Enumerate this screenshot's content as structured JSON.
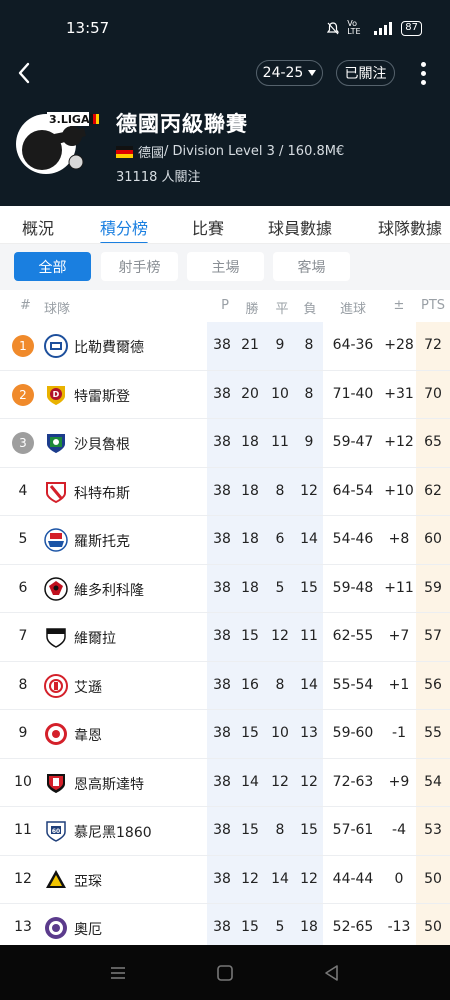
{
  "status": {
    "time": "13:57",
    "icons_text": "Vo LTE",
    "battery": "87"
  },
  "topbar": {
    "season": "24-25",
    "follow_label": "已關注"
  },
  "league": {
    "logo_text": "3.LIGA",
    "name": "德國丙級聯賽",
    "country": "德國",
    "meta_rest": " / Division Level 3 / 160.8M€",
    "followers": "31118 人關注"
  },
  "tabs": [
    "概況",
    "積分榜",
    "比賽",
    "球員數據",
    "球隊數據"
  ],
  "filters": [
    "全部",
    "射手榜",
    "主場",
    "客場"
  ],
  "table": {
    "headers": {
      "rank": "#",
      "team": "球隊",
      "p": "P",
      "w": "勝",
      "d": "平",
      "l": "負",
      "goals": "進球",
      "gd": "±",
      "pts": "PTS"
    },
    "rows": [
      {
        "rank": "1",
        "team": "比勒費爾德",
        "p": "38",
        "w": "21",
        "d": "9",
        "l": "8",
        "goals": "64-36",
        "gd": "+28",
        "pts": "72"
      },
      {
        "rank": "2",
        "team": "特雷斯登",
        "p": "38",
        "w": "20",
        "d": "10",
        "l": "8",
        "goals": "71-40",
        "gd": "+31",
        "pts": "70"
      },
      {
        "rank": "3",
        "team": "沙貝魯根",
        "p": "38",
        "w": "18",
        "d": "11",
        "l": "9",
        "goals": "59-47",
        "gd": "+12",
        "pts": "65"
      },
      {
        "rank": "4",
        "team": "科特布斯",
        "p": "38",
        "w": "18",
        "d": "8",
        "l": "12",
        "goals": "64-54",
        "gd": "+10",
        "pts": "62"
      },
      {
        "rank": "5",
        "team": "羅斯托克",
        "p": "38",
        "w": "18",
        "d": "6",
        "l": "14",
        "goals": "54-46",
        "gd": "+8",
        "pts": "60"
      },
      {
        "rank": "6",
        "team": "維多利科隆",
        "p": "38",
        "w": "18",
        "d": "5",
        "l": "15",
        "goals": "59-48",
        "gd": "+11",
        "pts": "59"
      },
      {
        "rank": "7",
        "team": "維爾拉",
        "p": "38",
        "w": "15",
        "d": "12",
        "l": "11",
        "goals": "62-55",
        "gd": "+7",
        "pts": "57"
      },
      {
        "rank": "8",
        "team": "艾遜",
        "p": "38",
        "w": "16",
        "d": "8",
        "l": "14",
        "goals": "55-54",
        "gd": "+1",
        "pts": "56"
      },
      {
        "rank": "9",
        "team": "韋恩",
        "p": "38",
        "w": "15",
        "d": "10",
        "l": "13",
        "goals": "59-60",
        "gd": "-1",
        "pts": "55"
      },
      {
        "rank": "10",
        "team": "恩高斯達特",
        "p": "38",
        "w": "14",
        "d": "12",
        "l": "12",
        "goals": "72-63",
        "gd": "+9",
        "pts": "54"
      },
      {
        "rank": "11",
        "team": "慕尼黑1860",
        "p": "38",
        "w": "15",
        "d": "8",
        "l": "15",
        "goals": "57-61",
        "gd": "-4",
        "pts": "53"
      },
      {
        "rank": "12",
        "team": "亞琛",
        "p": "38",
        "w": "12",
        "d": "14",
        "l": "12",
        "goals": "44-44",
        "gd": "0",
        "pts": "50"
      },
      {
        "rank": "13",
        "team": "奧厄",
        "p": "38",
        "w": "15",
        "d": "5",
        "l": "18",
        "goals": "52-65",
        "gd": "-13",
        "pts": "50"
      }
    ]
  },
  "colors": {
    "accent": "#1a7fe0",
    "header_bg": "#0f1b24",
    "rank_promotion": "#f08a2b",
    "rank_playoff": "#9e9e9e",
    "stats_col_bg": "#eef3fb",
    "pts_col_bg": "#fdf4e6"
  },
  "icons": {
    "back": "chevron-left-icon",
    "season_caret": "caret-down-icon",
    "more": "more-vertical-icon",
    "nav": [
      "menu-icon",
      "home-square-icon",
      "back-triangle-icon"
    ]
  }
}
